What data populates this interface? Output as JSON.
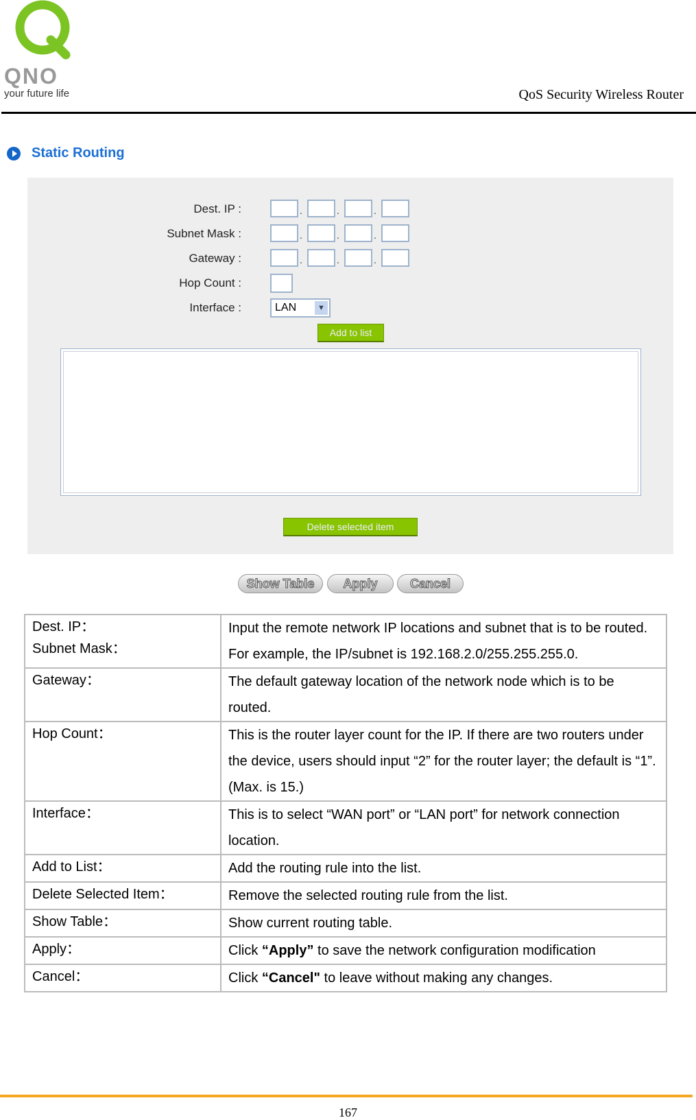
{
  "header": {
    "logo_text": "QNO",
    "logo_tagline": "your future life",
    "title": "QoS Security Wireless Router"
  },
  "section": {
    "title": "Static Routing",
    "icon": "circle-arrow-icon"
  },
  "form": {
    "dest_ip_label": "Dest. IP :",
    "subnet_mask_label": "Subnet Mask :",
    "gateway_label": "Gateway :",
    "hop_count_label": "Hop Count :",
    "interface_label": "Interface :",
    "interface_value": "LAN",
    "add_to_list": "Add to list",
    "delete_selected": "Delete selected item",
    "separator": "."
  },
  "buttons": {
    "show_table": "Show Table",
    "apply": "Apply",
    "cancel": "Cancel"
  },
  "colors": {
    "green_button": "#88c400",
    "section_blue": "#1a6fd4",
    "footer_line": "#f5a623"
  },
  "table": [
    {
      "k": [
        "Dest. IP：",
        "Subnet Mask："
      ],
      "v": "Input the remote network IP locations and subnet that is to be routed. For example, the IP/subnet is 192.168.2.0/255.255.255.0."
    },
    {
      "k": [
        "Gateway："
      ],
      "v": "The default gateway location of the network node which is to be routed."
    },
    {
      "k": [
        "Hop Count："
      ],
      "v": "This is the router layer count for the IP. If there are two routers under the device, users should input “2” for the router layer; the default is “1”. (Max. is 15.)"
    },
    {
      "k": [
        "Interface："
      ],
      "v": "This is to select “WAN port” or “LAN port” for network connection location."
    },
    {
      "k": [
        "Add to List："
      ],
      "v": "Add the routing rule into the list."
    },
    {
      "k": [
        "Delete Selected Item："
      ],
      "v": "Remove the selected routing rule from the list."
    },
    {
      "k": [
        "Show Table："
      ],
      "v": "Show current routing table."
    },
    {
      "k": [
        "Apply："
      ],
      "v_pre": "Click ",
      "v_bold": "“Apply”",
      "v_post": " to save the network configuration modification"
    },
    {
      "k": [
        "Cancel："
      ],
      "v_pre": "Click ",
      "v_bold": "“Cancel\"",
      "v_post": " to leave without making any changes."
    }
  ],
  "footer": {
    "page_number": "167"
  }
}
